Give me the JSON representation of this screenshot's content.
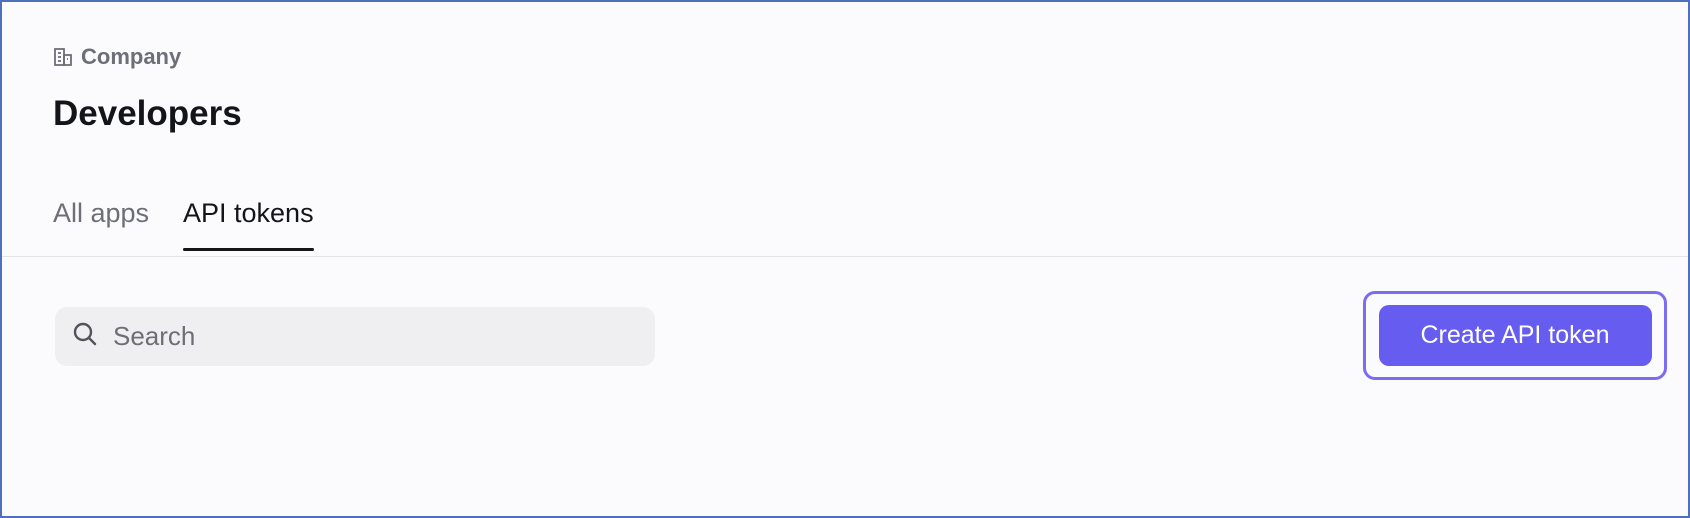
{
  "breadcrumb": {
    "icon": "building-icon",
    "label": "Company"
  },
  "page": {
    "title": "Developers"
  },
  "tabs": [
    {
      "label": "All apps",
      "active": false
    },
    {
      "label": "API tokens",
      "active": true
    }
  ],
  "search": {
    "placeholder": "Search",
    "value": "",
    "icon": "search-icon"
  },
  "actions": {
    "create_token_label": "Create API token"
  },
  "colors": {
    "accent": "#665cf0",
    "focus_ring": "#7b6cf0",
    "text_primary": "#14151a",
    "text_secondary": "#6d6e78"
  }
}
